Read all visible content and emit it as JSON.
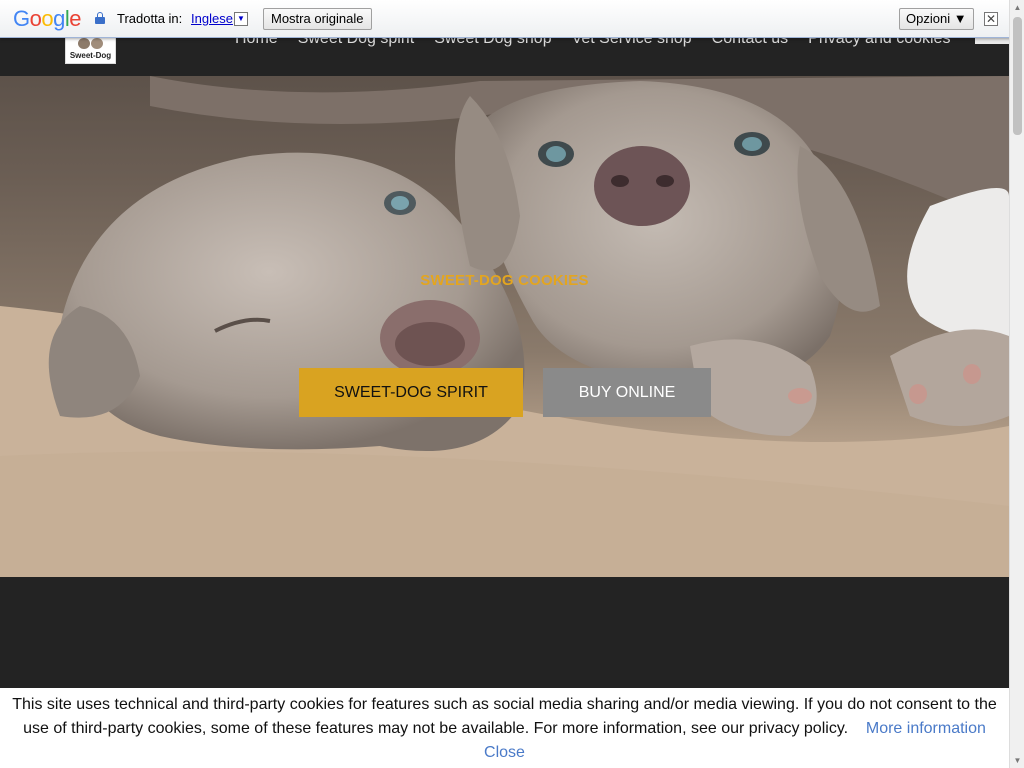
{
  "translate_bar": {
    "brand": "Google",
    "translated_in_label": "Tradotta in:",
    "language": "Inglese",
    "dropdown_glyph": "▼",
    "show_original": "Mostra originale",
    "options": "Opzioni ▼",
    "close_glyph": "✕"
  },
  "site": {
    "logo_text": "Sweet-Dog",
    "nav": [
      "Home",
      "Sweet Dog spirit",
      "Sweet Dog shop",
      "Vet Service shop",
      "Contact us",
      "Privacy and cookies"
    ]
  },
  "hero": {
    "title": "SWEET-DOG COOKIES",
    "primary_button": "SWEET-DOG SPIRIT",
    "secondary_button": "BUY ONLINE"
  },
  "cookie_banner": {
    "message": "This site uses technical and third-party cookies for features such as social media sharing and/or media viewing. If you do not consent to the use of third-party cookies, some of these features may not be available. For more information, see our privacy policy.",
    "more_info": "More information",
    "close": "Close"
  },
  "colors": {
    "accent": "#d9a321",
    "title_color": "#e3a520",
    "secondary_button": "#8a8a8a",
    "header_bg": "#232323",
    "link": "#4a7ac8"
  },
  "icons": [
    "lock-icon",
    "close-icon",
    "dropdown-arrow-icon"
  ]
}
